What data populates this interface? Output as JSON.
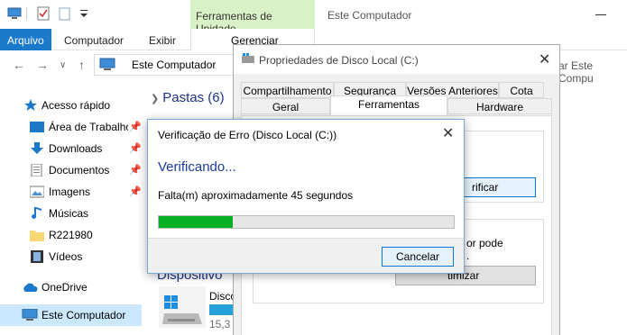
{
  "explorer": {
    "title": "Este Computador",
    "context_tab": "Ferramentas de Unidade",
    "ribbon_tabs": {
      "file": "Arquivo",
      "computer": "Computador",
      "view": "Exibir",
      "manage": "Gerenciar"
    },
    "address": "Este Computador",
    "search_placeholder": "ar Este Compu",
    "sidebar": [
      {
        "label": "Acesso rápido",
        "icon": "star-icon"
      },
      {
        "label": "Área de Trabalho",
        "icon": "desktop-folder-icon",
        "pinned": true
      },
      {
        "label": "Downloads",
        "icon": "download-arrow-icon",
        "pinned": true
      },
      {
        "label": "Documentos",
        "icon": "document-icon",
        "pinned": true
      },
      {
        "label": "Imagens",
        "icon": "image-icon",
        "pinned": true
      },
      {
        "label": "Músicas",
        "icon": "music-note-icon"
      },
      {
        "label": "R221980",
        "icon": "folder-icon"
      },
      {
        "label": "Vídeos",
        "icon": "video-icon"
      },
      {
        "label": "OneDrive",
        "icon": "cloud-icon"
      },
      {
        "label": "Este Computador",
        "icon": "computer-icon"
      }
    ],
    "folders_heading": "Pastas (6)",
    "devices_heading": "Dispositivo",
    "drive_name": "Disco",
    "drive_size": "15,3",
    "drive_usage_percent": 60
  },
  "properties": {
    "title": "Propriedades de Disco Local (C:)",
    "tabs_row1": [
      "Compartilhamento",
      "Segurança",
      "Versões Anteriores",
      "Cota"
    ],
    "tabs_row2": [
      "Geral",
      "Ferramentas",
      "Hardware"
    ],
    "active_tab": "Ferramentas",
    "check_button": "rificar",
    "optimize_text": "or pode",
    "optimize_text2": ".",
    "optimize_button": "timizar"
  },
  "dialog": {
    "title": "Verificação de Erro (Disco Local (C:))",
    "heading": "Verificando...",
    "remaining": "Falta(m) aproximadamente 45 segundos",
    "progress_percent": 25,
    "cancel": "Cancelar"
  },
  "colors": {
    "accent": "#1979ca",
    "progress": "#06b025",
    "heading": "#1a3b9e",
    "context_tab": "#d9f1c6"
  }
}
